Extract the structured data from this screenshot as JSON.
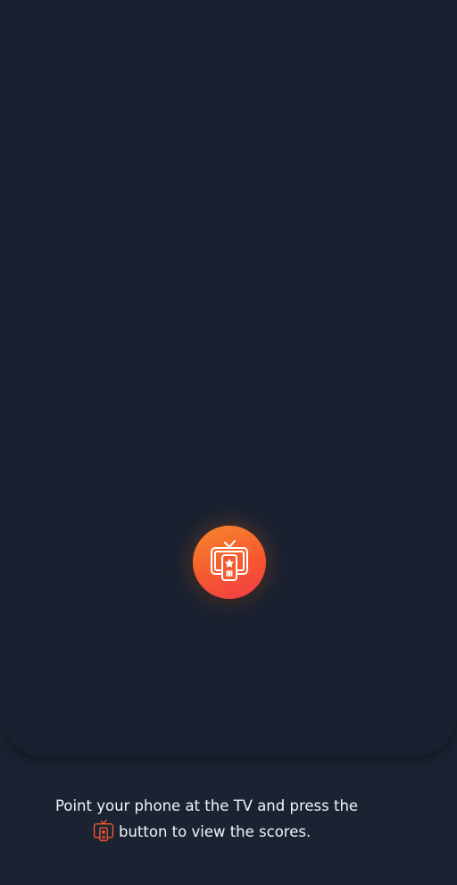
{
  "scanner": {
    "button_icon": "tv-remote-icon",
    "accent_start": "#f7892c",
    "accent_end": "#f43a48"
  },
  "instructions": {
    "line1": "Point your phone at the TV and press the",
    "inline_icon": "tv-remote-icon",
    "line2": "button to view the scores."
  }
}
